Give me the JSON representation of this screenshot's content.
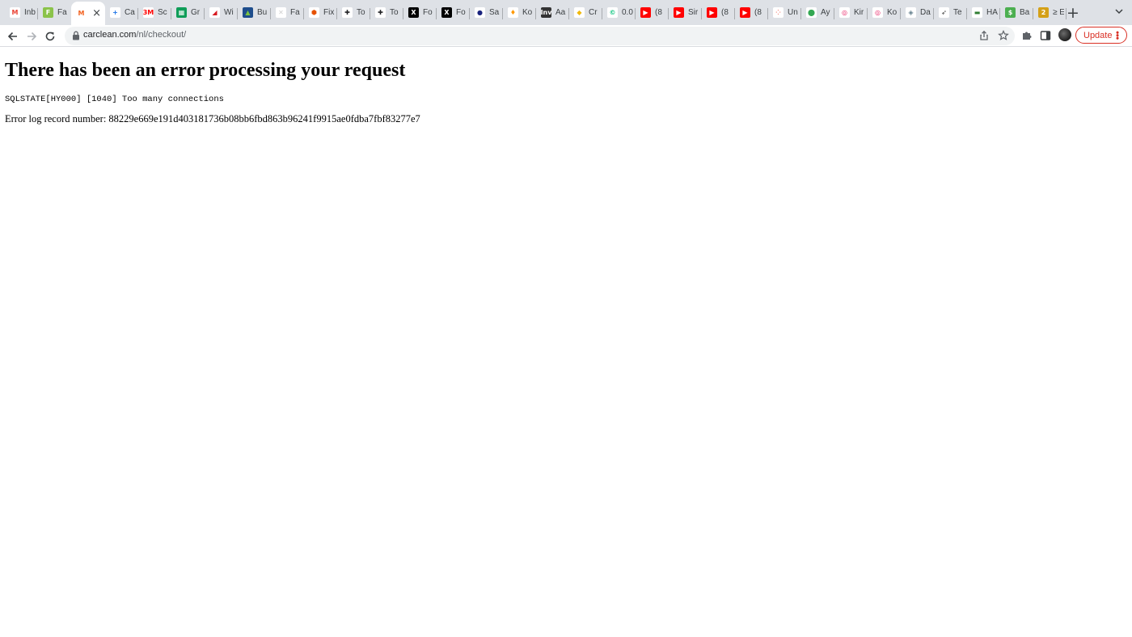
{
  "browser": {
    "tabs": [
      {
        "label": "Inb",
        "icon": "gmail-icon",
        "color": "#ea4335",
        "glyph": "M",
        "glyph_color": "#ea4335",
        "bg": "#ffffff"
      },
      {
        "label": "Fa",
        "icon": "document-icon",
        "color": "#8bc34a",
        "glyph": "F",
        "glyph_color": "#ffffff",
        "bg": "#8bc34a"
      },
      {
        "label": "",
        "icon": "magento-icon",
        "color": "#f26322",
        "glyph": "M",
        "glyph_color": "#f26322",
        "bg": "#ffffff",
        "active": true
      },
      {
        "label": "Ca",
        "icon": "plus-cross-icon",
        "color": "#1a73e8",
        "glyph": "+",
        "glyph_color": "#1a73e8",
        "bg": "#ffffff"
      },
      {
        "label": "Sc",
        "icon": "3m-icon",
        "color": "#ff0000",
        "glyph": "3M",
        "glyph_color": "#ff0000",
        "bg": "#ffffff"
      },
      {
        "label": "Gr",
        "icon": "sheets-icon",
        "color": "#0f9d58",
        "glyph": "▦",
        "glyph_color": "#ffffff",
        "bg": "#0f9d58"
      },
      {
        "label": "Wi",
        "icon": "airline-icon",
        "color": "#d71920",
        "glyph": "◢",
        "glyph_color": "#d71920",
        "bg": "#ffffff"
      },
      {
        "label": "Bu",
        "icon": "chart-icon",
        "color": "#1e4d8c",
        "glyph": "▲",
        "glyph_color": "#7cc242",
        "bg": "#1e4d8c"
      },
      {
        "label": "Fa",
        "icon": "blank-page-icon",
        "color": "#e0e0e0",
        "glyph": "✕",
        "glyph_color": "#cfcfcf",
        "bg": "#ffffff"
      },
      {
        "label": "Fix",
        "icon": "shield-icon",
        "color": "#e65100",
        "glyph": "⬢",
        "glyph_color": "#e65100",
        "bg": "#ffffff"
      },
      {
        "label": "To",
        "icon": "plus-circle-icon",
        "color": "#202124",
        "glyph": "✚",
        "glyph_color": "#202124",
        "bg": "#ffffff"
      },
      {
        "label": "To",
        "icon": "plus-circle-icon",
        "color": "#202124",
        "glyph": "✚",
        "glyph_color": "#202124",
        "bg": "#ffffff"
      },
      {
        "label": "Fo",
        "icon": "x-icon",
        "color": "#000000",
        "glyph": "X",
        "glyph_color": "#ffffff",
        "bg": "#000000"
      },
      {
        "label": "Fo",
        "icon": "x-icon",
        "color": "#000000",
        "glyph": "X",
        "glyph_color": "#ffffff",
        "bg": "#000000"
      },
      {
        "label": "Sa",
        "icon": "circle-logo-icon",
        "color": "#1a237e",
        "glyph": "●",
        "glyph_color": "#1a237e",
        "bg": "#ffffff"
      },
      {
        "label": "Ko",
        "icon": "flame-icon",
        "color": "#ff9800",
        "glyph": "♦",
        "glyph_color": "#ff9800",
        "bg": "#ffffff"
      },
      {
        "label": "Aa",
        "icon": "investing-icon",
        "color": "#333333",
        "glyph": "Inv",
        "glyph_color": "#ffffff",
        "bg": "#333333"
      },
      {
        "label": "Cr",
        "icon": "binance-icon",
        "color": "#f0b90b",
        "glyph": "◆",
        "glyph_color": "#f0b90b",
        "bg": "#ffffff"
      },
      {
        "label": "0.0",
        "icon": "coin-icon",
        "color": "#16c784",
        "glyph": "©",
        "glyph_color": "#16c784",
        "bg": "#ffffff"
      },
      {
        "label": "(8",
        "icon": "youtube-icon",
        "color": "#ff0000",
        "glyph": "▶",
        "glyph_color": "#ffffff",
        "bg": "#ff0000"
      },
      {
        "label": "Sir",
        "icon": "youtube-icon",
        "color": "#ff0000",
        "glyph": "▶",
        "glyph_color": "#ffffff",
        "bg": "#ff0000"
      },
      {
        "label": "(8",
        "icon": "youtube-icon",
        "color": "#ff0000",
        "glyph": "▶",
        "glyph_color": "#ffffff",
        "bg": "#ff0000"
      },
      {
        "label": "(8",
        "icon": "youtube-icon",
        "color": "#ff0000",
        "glyph": "▶",
        "glyph_color": "#ffffff",
        "bg": "#ff0000"
      },
      {
        "label": "Un",
        "icon": "dots-icon",
        "color": "#f28b82",
        "glyph": "⁘",
        "glyph_color": "#f28b82",
        "bg": "#ffffff"
      },
      {
        "label": "Ay",
        "icon": "maps-pin-icon",
        "color": "#34a853",
        "glyph": "⬤",
        "glyph_color": "#34a853",
        "bg": "#ffffff"
      },
      {
        "label": "Kir",
        "icon": "swirl-icon",
        "color": "#e91e63",
        "glyph": "◎",
        "glyph_color": "#e91e63",
        "bg": "#ffffff"
      },
      {
        "label": "Ko",
        "icon": "swirl-icon",
        "color": "#e91e63",
        "glyph": "◎",
        "glyph_color": "#e91e63",
        "bg": "#ffffff"
      },
      {
        "label": "Da",
        "icon": "layers-icon",
        "color": "#607d8b",
        "glyph": "◈",
        "glyph_color": "#607d8b",
        "bg": "#ffffff"
      },
      {
        "label": "Te",
        "icon": "wing-icon",
        "color": "#333333",
        "glyph": "➶",
        "glyph_color": "#333333",
        "bg": "#ffffff"
      },
      {
        "label": "HA",
        "icon": "card-icon",
        "color": "#2e7d32",
        "glyph": "▬",
        "glyph_color": "#2e7d32",
        "bg": "#ffffff"
      },
      {
        "label": "Ba",
        "icon": "dollar-icon",
        "color": "#4caf50",
        "glyph": "$",
        "glyph_color": "#ffffff",
        "bg": "#4caf50"
      },
      {
        "label": "≥ E",
        "icon": "coin-icon",
        "color": "#f7931a",
        "glyph": "2",
        "glyph_color": "#ffffff",
        "bg": "#d4a017"
      }
    ],
    "new_tab_label": "+",
    "tab_search_label": "⌄",
    "url_host": "carclean.com",
    "url_path": "/nl/checkout/",
    "update_label": "Update",
    "accent_color": "#d93025"
  },
  "page": {
    "heading": "There has been an error processing your request",
    "sql_error": "SQLSTATE[HY000] [1040] Too many connections",
    "log_record": "Error log record number: 88229e669e191d403181736b08bb6fbd863b96241f9915ae0fdba7fbf83277e7"
  }
}
